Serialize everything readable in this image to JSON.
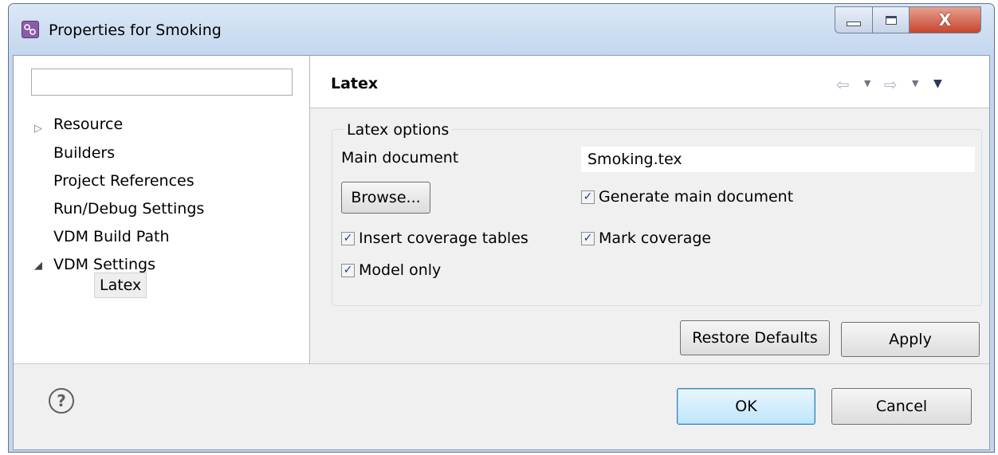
{
  "window": {
    "title": "Properties for Smoking",
    "close_glyph": "X"
  },
  "filter": {
    "value": "",
    "placeholder": ""
  },
  "tree": {
    "items": [
      {
        "label": "Resource",
        "toggle": "▷"
      },
      {
        "label": "Builders"
      },
      {
        "label": "Project References"
      },
      {
        "label": "Run/Debug Settings"
      },
      {
        "label": "VDM Build Path"
      },
      {
        "label": "VDM Settings",
        "toggle": "◢"
      },
      {
        "label": "Latex"
      }
    ]
  },
  "page": {
    "title": "Latex",
    "nav_back": "⇦",
    "nav_forward": "⇨",
    "nav_drop": "▼",
    "nav_menu": "▼"
  },
  "latex_options": {
    "group_label": "Latex options",
    "main_document_label": "Main document",
    "main_document_value": "Smoking.tex",
    "browse_label": "Browse...",
    "checkboxes": [
      {
        "label": "Generate main document",
        "checked": true
      },
      {
        "label": "Insert coverage tables",
        "checked": true
      },
      {
        "label": "Mark coverage",
        "checked": true
      },
      {
        "label": "Model only",
        "checked": true
      }
    ],
    "check_glyph": "✓"
  },
  "buttons": {
    "restore_defaults": "Restore Defaults",
    "apply": "Apply",
    "ok": "OK",
    "cancel": "Cancel"
  },
  "help": {
    "glyph": "?"
  }
}
